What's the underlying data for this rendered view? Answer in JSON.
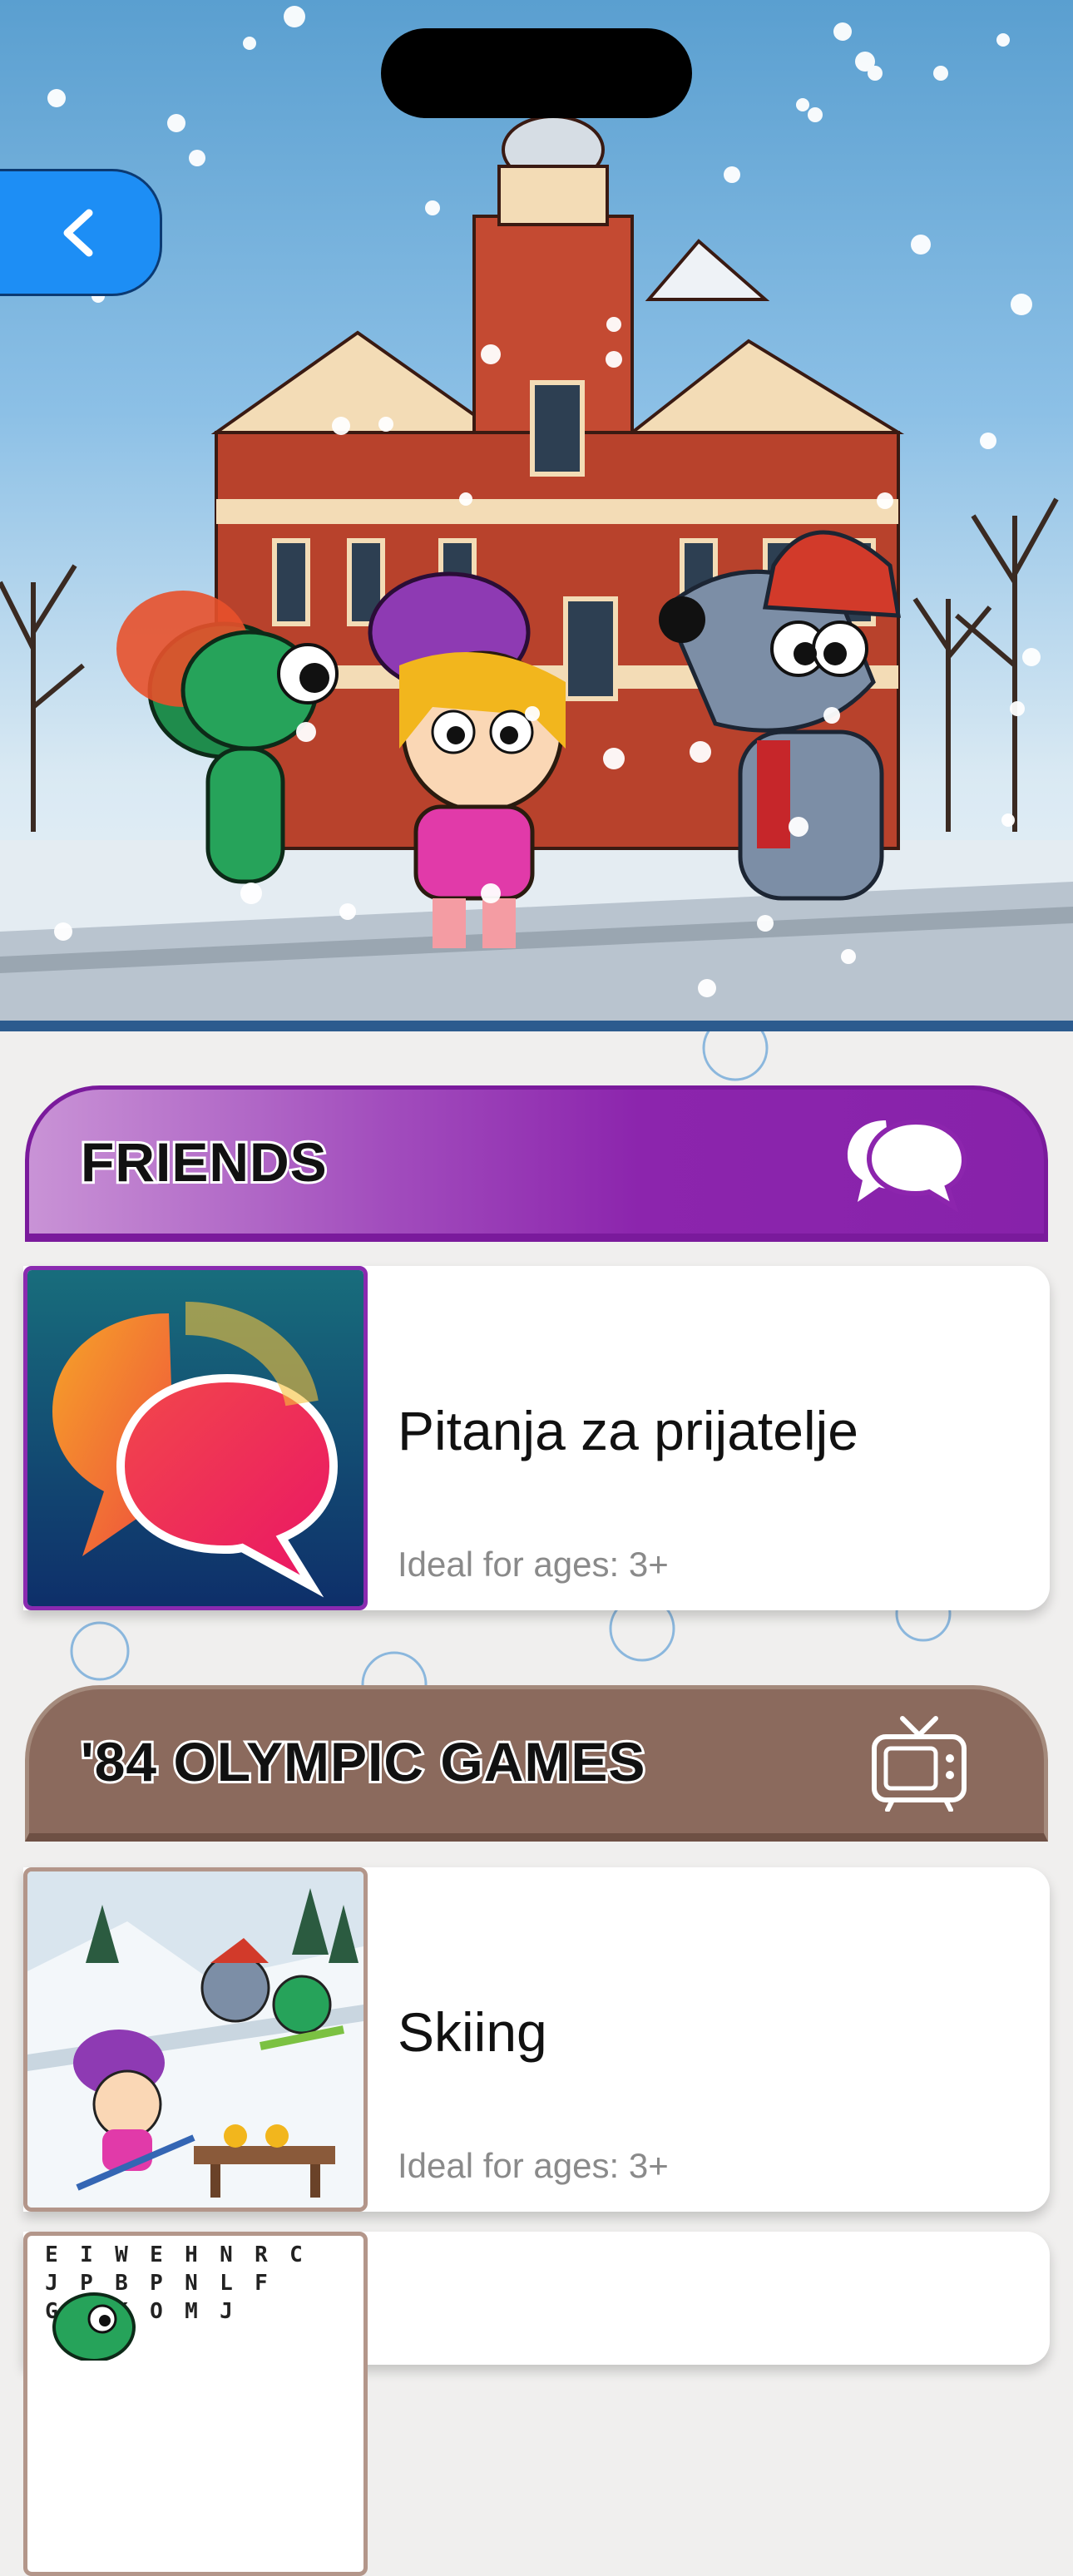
{
  "hero": {
    "back_icon": "chevron-left-icon"
  },
  "sections": [
    {
      "title": "FRIENDS",
      "icon": "chat-bubbles-icon",
      "color": "#8c25ad",
      "items": [
        {
          "title": "Pitanja za prijatelje",
          "ages": "Ideal for ages: 3+"
        }
      ]
    },
    {
      "title": "'84 OLYMPIC GAMES",
      "icon": "tv-icon",
      "color": "#8b6a5d",
      "items": [
        {
          "title": "Skiing",
          "ages": "Ideal for ages: 3+"
        },
        {
          "letters": [
            "E",
            "I",
            "W",
            "E",
            "H",
            "N",
            "R",
            "C",
            "",
            "J",
            "P",
            "B",
            "P",
            "N",
            "L",
            "F",
            "",
            "",
            "G",
            "N",
            "K",
            "O",
            "M",
            "J"
          ]
        }
      ]
    }
  ]
}
